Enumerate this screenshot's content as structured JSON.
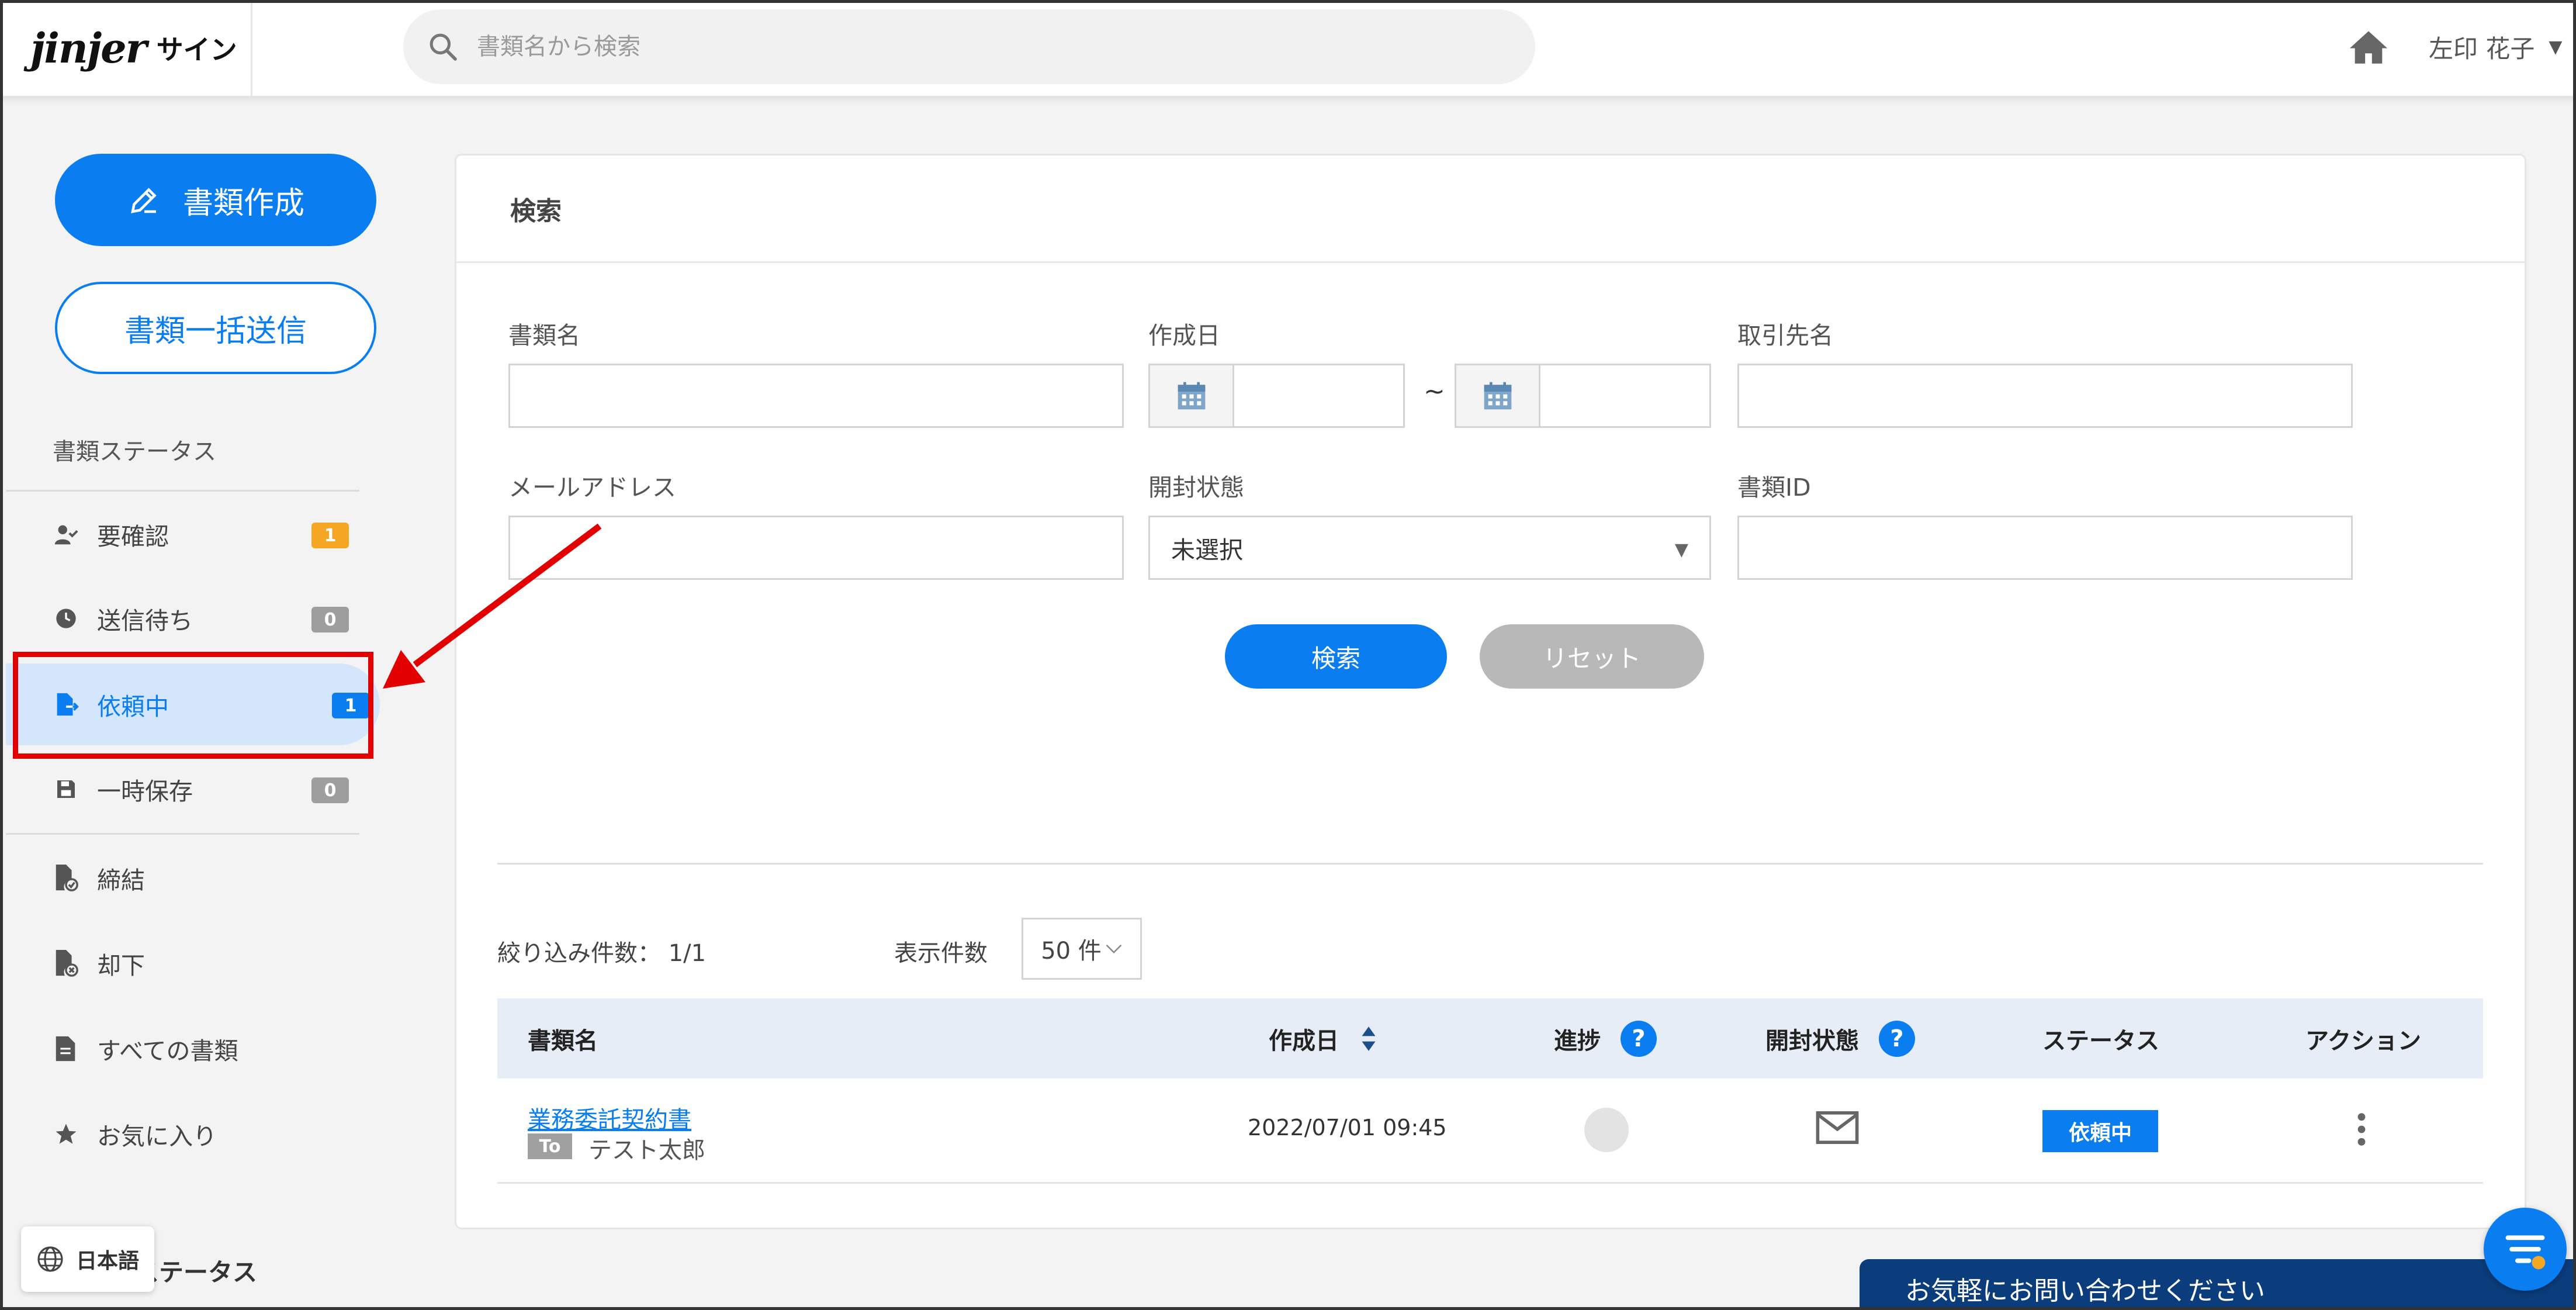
{
  "header": {
    "logo_brand": "jinjer",
    "logo_product": "サイン",
    "search_placeholder": "書類名から検索",
    "user_name": "左印 花子"
  },
  "sidebar": {
    "create_button": "書類作成",
    "bulk_send_button": "書類一括送信",
    "section_label": "書類ステータス",
    "items": [
      {
        "label": "要確認",
        "badge": "1",
        "icon": "user-check-icon",
        "badge_color": "#f5a623"
      },
      {
        "label": "送信待ち",
        "badge": "0",
        "icon": "clock-icon",
        "badge_color": "#9e9e9e"
      },
      {
        "label": "依頼中",
        "badge": "1",
        "icon": "document-send-icon",
        "badge_color": "#0a7ef0",
        "active": true
      },
      {
        "label": "一時保存",
        "badge": "0",
        "icon": "save-icon",
        "badge_color": "#9e9e9e"
      },
      {
        "label": "締結",
        "icon": "document-check-icon"
      },
      {
        "label": "却下",
        "icon": "document-reject-icon"
      },
      {
        "label": "すべての書類",
        "icon": "document-icon"
      },
      {
        "label": "お気に入り",
        "icon": "star-icon"
      }
    ],
    "language_button": "日本語",
    "bottom_section_label": "ステータス"
  },
  "search_panel": {
    "title": "検索",
    "fields": {
      "doc_name_label": "書類名",
      "created_label": "作成日",
      "date_separator": "~",
      "partner_label": "取引先名",
      "email_label": "メールアドレス",
      "open_status_label": "開封状態",
      "open_status_value": "未選択",
      "doc_id_label": "書類ID"
    },
    "search_button": "検索",
    "reset_button": "リセット"
  },
  "results": {
    "count_label": "絞り込み件数：",
    "count_value": "1/1",
    "per_page_label": "表示件数",
    "per_page_value": "50 件",
    "columns": [
      "書類名",
      "作成日",
      "進捗",
      "開封状態",
      "ステータス",
      "アクション"
    ],
    "rows": [
      {
        "doc_name": "業務委託契約書",
        "to_label": "To",
        "recipient": "テスト太郎",
        "created": "2022/07/01 09:45",
        "status": "依頼中"
      }
    ]
  },
  "footer": {
    "contact_text": "お気軽にお問い合わせください"
  },
  "colors": {
    "accent": "#0a7ef0",
    "highlight": "#e20000",
    "contact_bar": "#0b3d7c"
  }
}
